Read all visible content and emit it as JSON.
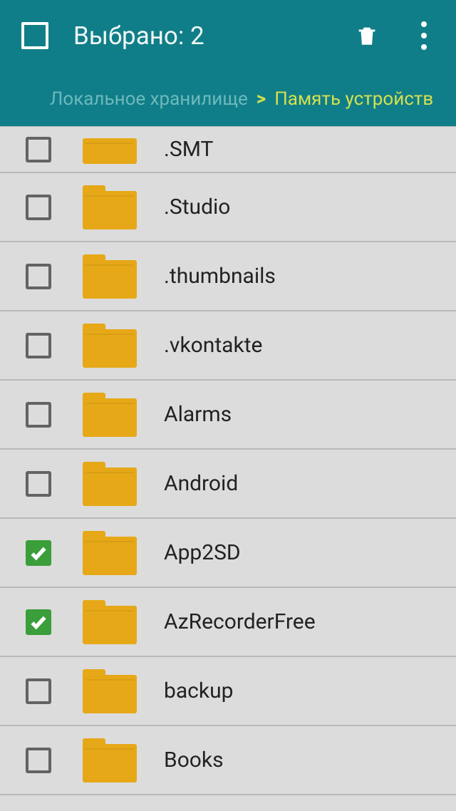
{
  "header": {
    "select_all_checked": false,
    "title": "Выбрано: 2"
  },
  "breadcrumb": {
    "root": "Локальное хранилище",
    "sep": ">",
    "current": "Память устройств"
  },
  "folders": [
    {
      "name": ".SMT",
      "checked": false,
      "partial": true
    },
    {
      "name": ".Studio",
      "checked": false
    },
    {
      "name": ".thumbnails",
      "checked": false
    },
    {
      "name": ".vkontakte",
      "checked": false
    },
    {
      "name": "Alarms",
      "checked": false
    },
    {
      "name": "Android",
      "checked": false
    },
    {
      "name": "App2SD",
      "checked": true
    },
    {
      "name": "AzRecorderFree",
      "checked": true
    },
    {
      "name": "backup",
      "checked": false
    },
    {
      "name": "Books",
      "checked": false
    }
  ]
}
